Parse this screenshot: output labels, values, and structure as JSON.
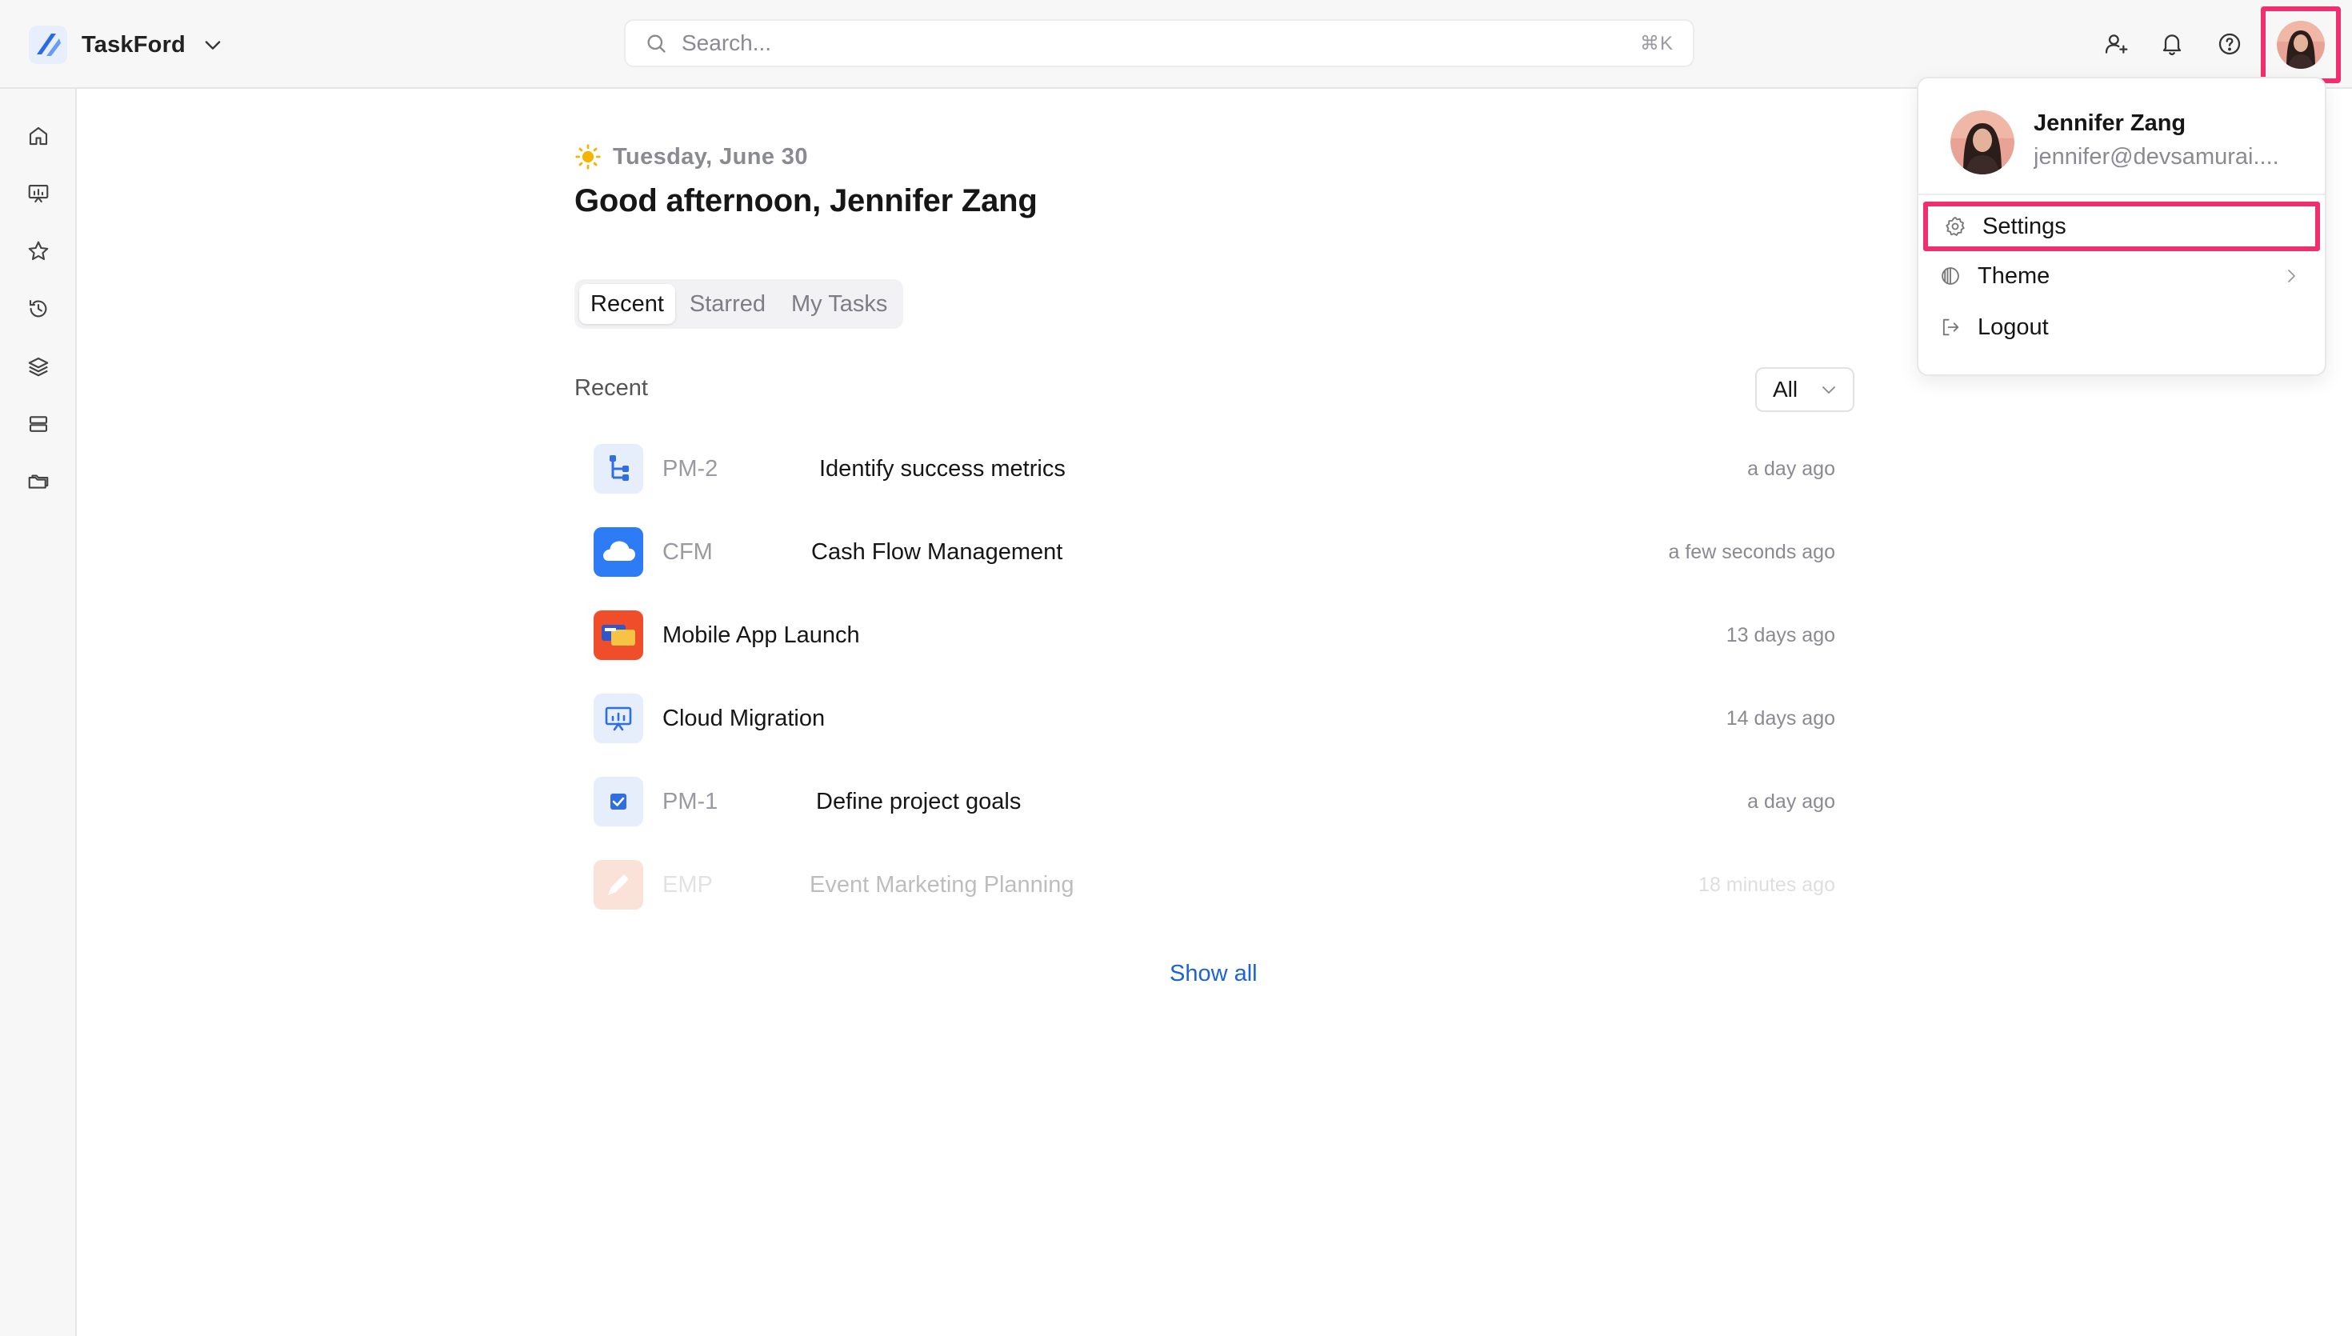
{
  "app": {
    "name": "TaskFord"
  },
  "search": {
    "placeholder": "Search...",
    "shortcut": "⌘K"
  },
  "header_icons": [
    "add-member-icon",
    "bell-icon",
    "help-icon",
    "avatar"
  ],
  "sidebar": {
    "items": [
      {
        "name": "home",
        "icon": "home-icon"
      },
      {
        "name": "dashboard",
        "icon": "presentation-icon"
      },
      {
        "name": "starred",
        "icon": "star-icon"
      },
      {
        "name": "history",
        "icon": "history-icon"
      },
      {
        "name": "layers",
        "icon": "layers-icon"
      },
      {
        "name": "storage",
        "icon": "server-icon"
      },
      {
        "name": "folders",
        "icon": "folder-icon"
      }
    ]
  },
  "main": {
    "date": "Tuesday, June 30",
    "greeting": "Good afternoon, Jennifer Zang",
    "tabs": [
      {
        "label": "Recent",
        "active": true
      },
      {
        "label": "Starred",
        "active": false
      },
      {
        "label": "My Tasks",
        "active": false
      }
    ],
    "section_label": "Recent",
    "filter": {
      "value": "All"
    },
    "items": [
      {
        "key": "PM-2",
        "name": "Identify success metrics",
        "time": "a day ago",
        "icon": "subtask-icon"
      },
      {
        "key": "CFM",
        "name": "Cash Flow Management",
        "time": "a few seconds ago",
        "icon": "cloud-icon"
      },
      {
        "key": "",
        "name": "Mobile App Launch",
        "time": "13 days ago",
        "icon": "cards-icon"
      },
      {
        "key": "",
        "name": "Cloud Migration",
        "time": "14 days ago",
        "icon": "presentation-board-icon"
      },
      {
        "key": "PM-1",
        "name": "Define project goals",
        "time": "a day ago",
        "icon": "checkbox-icon"
      },
      {
        "key": "EMP",
        "name": "Event Marketing Planning",
        "time": "18 minutes ago",
        "icon": "pen-icon"
      }
    ],
    "show_all": "Show all"
  },
  "user_menu": {
    "name": "Jennifer Zang",
    "email": "jennifer@devsamurai....",
    "items": [
      {
        "label": "Settings",
        "icon": "gear-icon",
        "highlighted": true
      },
      {
        "label": "Theme",
        "icon": "theme-icon",
        "has_submenu": true
      },
      {
        "label": "Logout",
        "icon": "logout-icon"
      }
    ]
  },
  "colors": {
    "highlight": "#f0306e",
    "link": "#1d63d6",
    "topbar_bg": "#f7f7f8"
  }
}
